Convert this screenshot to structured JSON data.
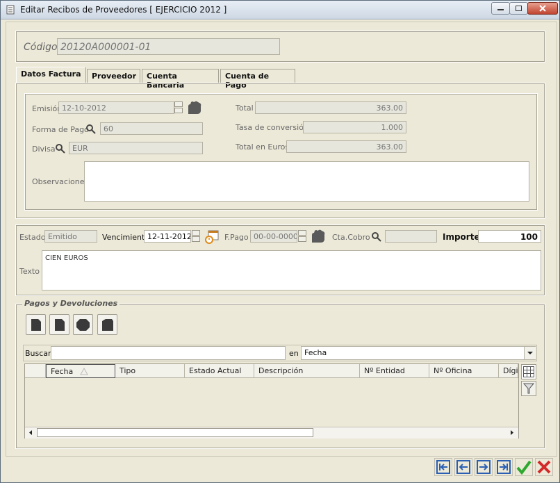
{
  "window": {
    "title": "Editar Recibos de Proveedores [ EJERCICIO 2012 ]"
  },
  "codigo": {
    "label": "Código",
    "value": "20120A000001-01"
  },
  "tabs": [
    {
      "label": "Datos Factura"
    },
    {
      "label": "Proveedor"
    },
    {
      "label": "Cuenta Bancaria"
    },
    {
      "label": "Cuenta de Pago"
    }
  ],
  "factura": {
    "emision_label": "Emisión",
    "emision_value": "12-10-2012",
    "forma_pago_label": "Forma de Pago",
    "forma_pago_value": "60",
    "divisa_label": "Divisa",
    "divisa_value": "EUR",
    "total_label": "Total",
    "total_value": "363.00",
    "tasa_label": "Tasa de conversión",
    "tasa_value": "1.000",
    "total_euros_label": "Total en Euros",
    "total_euros_value": "363.00",
    "observaciones_label": "Observaciones",
    "observaciones_value": ""
  },
  "recibo": {
    "estado_label": "Estado",
    "estado_value": "Emitido",
    "vencimiento_label": "Vencimiento",
    "vencimiento_value": "12-11-2012",
    "fpago_label": "F.Pago",
    "fpago_value": "00-00-0000",
    "cta_cobro_label": "Cta.Cobro",
    "cta_cobro_value": "",
    "importe_label": "Importe",
    "importe_value": "100",
    "texto_label": "Texto",
    "texto_value": "CIEN EUROS"
  },
  "pagos": {
    "title": "Pagos y Devoluciones",
    "buscar_label": "Buscar",
    "buscar_value": "",
    "en_label": "en",
    "en_value": "Fecha",
    "columns": [
      "Fecha",
      "Tipo",
      "Estado Actual",
      "Descripción",
      "Nº Entidad",
      "Nº Oficina",
      "Dígit"
    ]
  },
  "colors": {
    "accept": "#2ea82e",
    "cancel": "#d42a2a",
    "nav": "#2b5fb3"
  },
  "icons": [
    "document-icon",
    "calendar-icon",
    "search-icon",
    "hand-icon",
    "grid-icon",
    "filter-icon",
    "first-icon",
    "prev-icon",
    "next-icon",
    "last-icon",
    "check-icon",
    "cancel-icon"
  ]
}
